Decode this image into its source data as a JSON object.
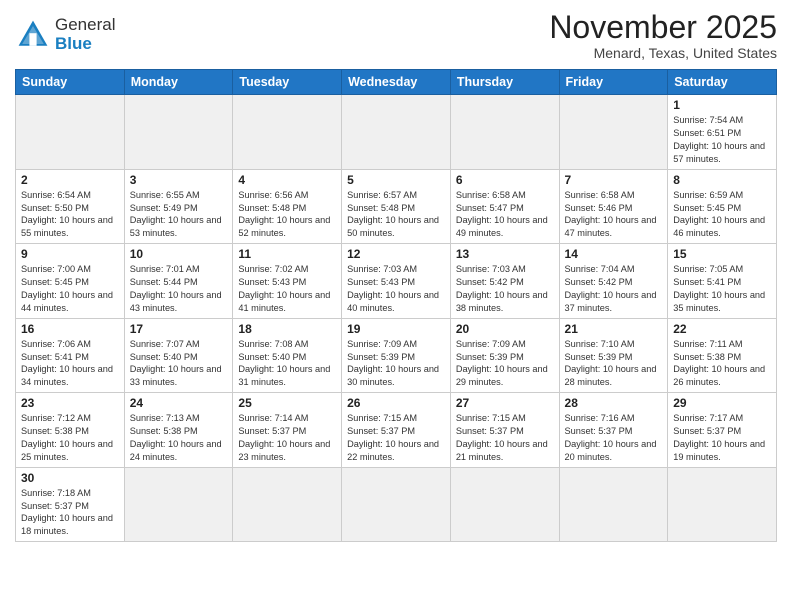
{
  "header": {
    "logo_general": "General",
    "logo_blue": "Blue",
    "month_title": "November 2025",
    "location": "Menard, Texas, United States"
  },
  "days_of_week": [
    "Sunday",
    "Monday",
    "Tuesday",
    "Wednesday",
    "Thursday",
    "Friday",
    "Saturday"
  ],
  "weeks": [
    [
      {
        "day": "",
        "info": ""
      },
      {
        "day": "",
        "info": ""
      },
      {
        "day": "",
        "info": ""
      },
      {
        "day": "",
        "info": ""
      },
      {
        "day": "",
        "info": ""
      },
      {
        "day": "",
        "info": ""
      },
      {
        "day": "1",
        "info": "Sunrise: 7:54 AM\nSunset: 6:51 PM\nDaylight: 10 hours and 57 minutes."
      }
    ],
    [
      {
        "day": "2",
        "info": "Sunrise: 6:54 AM\nSunset: 5:50 PM\nDaylight: 10 hours and 55 minutes."
      },
      {
        "day": "3",
        "info": "Sunrise: 6:55 AM\nSunset: 5:49 PM\nDaylight: 10 hours and 53 minutes."
      },
      {
        "day": "4",
        "info": "Sunrise: 6:56 AM\nSunset: 5:48 PM\nDaylight: 10 hours and 52 minutes."
      },
      {
        "day": "5",
        "info": "Sunrise: 6:57 AM\nSunset: 5:48 PM\nDaylight: 10 hours and 50 minutes."
      },
      {
        "day": "6",
        "info": "Sunrise: 6:58 AM\nSunset: 5:47 PM\nDaylight: 10 hours and 49 minutes."
      },
      {
        "day": "7",
        "info": "Sunrise: 6:58 AM\nSunset: 5:46 PM\nDaylight: 10 hours and 47 minutes."
      },
      {
        "day": "8",
        "info": "Sunrise: 6:59 AM\nSunset: 5:45 PM\nDaylight: 10 hours and 46 minutes."
      }
    ],
    [
      {
        "day": "9",
        "info": "Sunrise: 7:00 AM\nSunset: 5:45 PM\nDaylight: 10 hours and 44 minutes."
      },
      {
        "day": "10",
        "info": "Sunrise: 7:01 AM\nSunset: 5:44 PM\nDaylight: 10 hours and 43 minutes."
      },
      {
        "day": "11",
        "info": "Sunrise: 7:02 AM\nSunset: 5:43 PM\nDaylight: 10 hours and 41 minutes."
      },
      {
        "day": "12",
        "info": "Sunrise: 7:03 AM\nSunset: 5:43 PM\nDaylight: 10 hours and 40 minutes."
      },
      {
        "day": "13",
        "info": "Sunrise: 7:03 AM\nSunset: 5:42 PM\nDaylight: 10 hours and 38 minutes."
      },
      {
        "day": "14",
        "info": "Sunrise: 7:04 AM\nSunset: 5:42 PM\nDaylight: 10 hours and 37 minutes."
      },
      {
        "day": "15",
        "info": "Sunrise: 7:05 AM\nSunset: 5:41 PM\nDaylight: 10 hours and 35 minutes."
      }
    ],
    [
      {
        "day": "16",
        "info": "Sunrise: 7:06 AM\nSunset: 5:41 PM\nDaylight: 10 hours and 34 minutes."
      },
      {
        "day": "17",
        "info": "Sunrise: 7:07 AM\nSunset: 5:40 PM\nDaylight: 10 hours and 33 minutes."
      },
      {
        "day": "18",
        "info": "Sunrise: 7:08 AM\nSunset: 5:40 PM\nDaylight: 10 hours and 31 minutes."
      },
      {
        "day": "19",
        "info": "Sunrise: 7:09 AM\nSunset: 5:39 PM\nDaylight: 10 hours and 30 minutes."
      },
      {
        "day": "20",
        "info": "Sunrise: 7:09 AM\nSunset: 5:39 PM\nDaylight: 10 hours and 29 minutes."
      },
      {
        "day": "21",
        "info": "Sunrise: 7:10 AM\nSunset: 5:39 PM\nDaylight: 10 hours and 28 minutes."
      },
      {
        "day": "22",
        "info": "Sunrise: 7:11 AM\nSunset: 5:38 PM\nDaylight: 10 hours and 26 minutes."
      }
    ],
    [
      {
        "day": "23",
        "info": "Sunrise: 7:12 AM\nSunset: 5:38 PM\nDaylight: 10 hours and 25 minutes."
      },
      {
        "day": "24",
        "info": "Sunrise: 7:13 AM\nSunset: 5:38 PM\nDaylight: 10 hours and 24 minutes."
      },
      {
        "day": "25",
        "info": "Sunrise: 7:14 AM\nSunset: 5:37 PM\nDaylight: 10 hours and 23 minutes."
      },
      {
        "day": "26",
        "info": "Sunrise: 7:15 AM\nSunset: 5:37 PM\nDaylight: 10 hours and 22 minutes."
      },
      {
        "day": "27",
        "info": "Sunrise: 7:15 AM\nSunset: 5:37 PM\nDaylight: 10 hours and 21 minutes."
      },
      {
        "day": "28",
        "info": "Sunrise: 7:16 AM\nSunset: 5:37 PM\nDaylight: 10 hours and 20 minutes."
      },
      {
        "day": "29",
        "info": "Sunrise: 7:17 AM\nSunset: 5:37 PM\nDaylight: 10 hours and 19 minutes."
      }
    ],
    [
      {
        "day": "30",
        "info": "Sunrise: 7:18 AM\nSunset: 5:37 PM\nDaylight: 10 hours and 18 minutes."
      },
      {
        "day": "",
        "info": ""
      },
      {
        "day": "",
        "info": ""
      },
      {
        "day": "",
        "info": ""
      },
      {
        "day": "",
        "info": ""
      },
      {
        "day": "",
        "info": ""
      },
      {
        "day": "",
        "info": ""
      }
    ]
  ]
}
